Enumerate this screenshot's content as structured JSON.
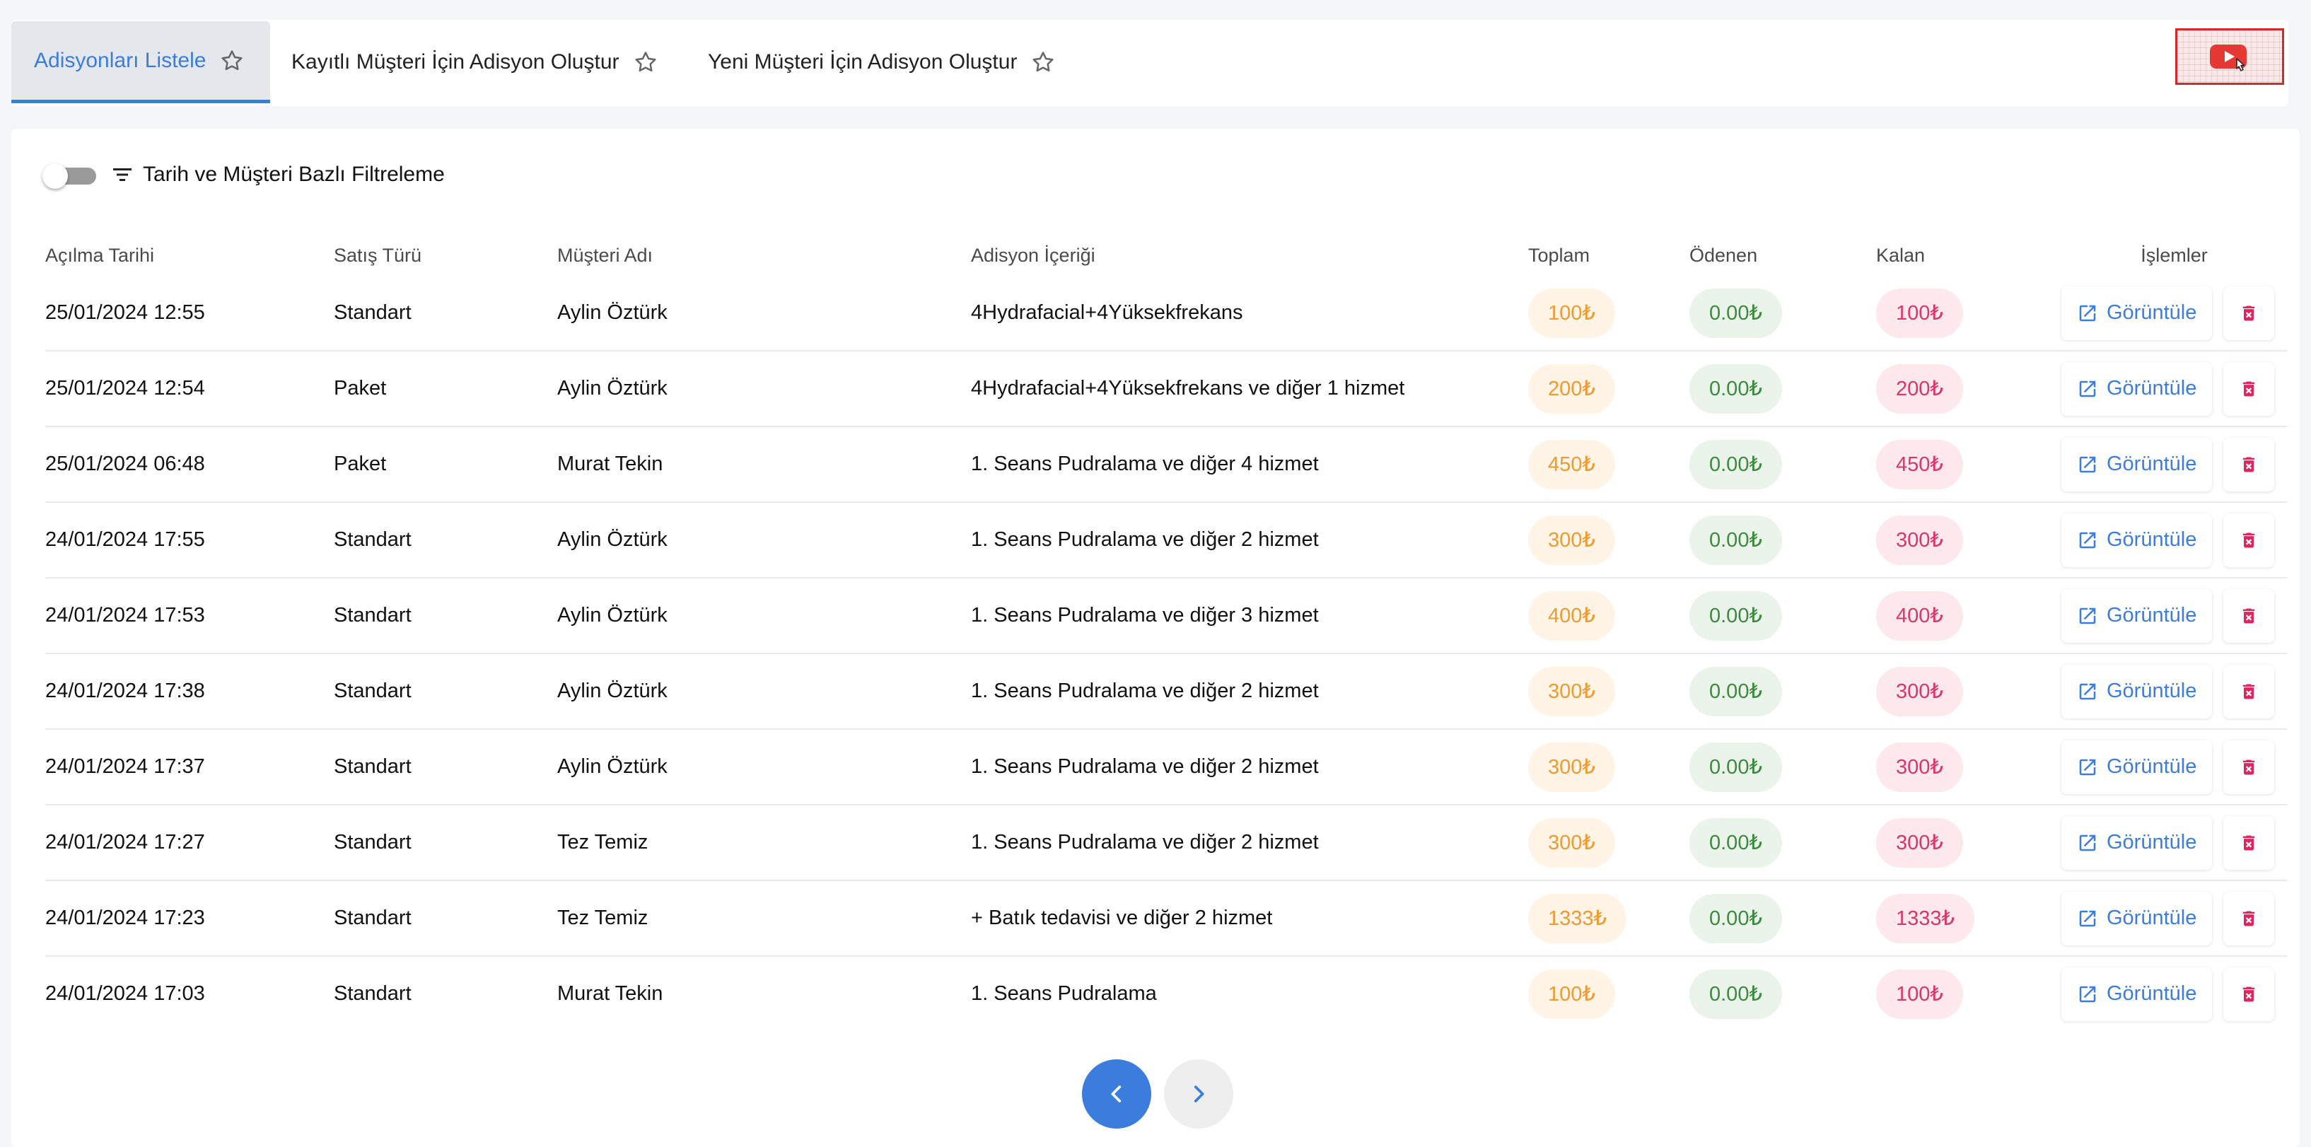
{
  "tabs": [
    {
      "label": "Adisyonları Listele",
      "active": true
    },
    {
      "label": "Kayıtlı Müşteri İçin Adisyon Oluştur",
      "active": false
    },
    {
      "label": "Yeni Müşteri İçin Adisyon Oluştur",
      "active": false
    }
  ],
  "video_button": {
    "icon": "youtube-play-icon",
    "color": "#e53935"
  },
  "filter": {
    "label": "Tarih ve Müşteri Bazlı Filtreleme",
    "enabled": false
  },
  "table": {
    "headers": [
      "Açılma Tarihi",
      "Satış Türü",
      "Müşteri Adı",
      "Adisyon İçeriği",
      "Toplam",
      "Ödenen",
      "Kalan",
      "İşlemler"
    ],
    "view_label": "Görüntüle",
    "rows": [
      {
        "date": "25/01/2024 12:55",
        "type": "Standart",
        "customer": "Aylin Öztürk",
        "content": "4Hydrafacial+4Yüksekfrekans",
        "total": "100₺",
        "paid": "0.00₺",
        "remaining": "100₺"
      },
      {
        "date": "25/01/2024 12:54",
        "type": "Paket",
        "customer": "Aylin Öztürk",
        "content": "4Hydrafacial+4Yüksekfrekans ve diğer 1 hizmet",
        "total": "200₺",
        "paid": "0.00₺",
        "remaining": "200₺"
      },
      {
        "date": "25/01/2024 06:48",
        "type": "Paket",
        "customer": "Murat Tekin",
        "content": "1. Seans Pudralama ve diğer 4 hizmet",
        "total": "450₺",
        "paid": "0.00₺",
        "remaining": "450₺"
      },
      {
        "date": "24/01/2024 17:55",
        "type": "Standart",
        "customer": "Aylin Öztürk",
        "content": "1. Seans Pudralama ve diğer 2 hizmet",
        "total": "300₺",
        "paid": "0.00₺",
        "remaining": "300₺"
      },
      {
        "date": "24/01/2024 17:53",
        "type": "Standart",
        "customer": "Aylin Öztürk",
        "content": "1. Seans Pudralama ve diğer 3 hizmet",
        "total": "400₺",
        "paid": "0.00₺",
        "remaining": "400₺"
      },
      {
        "date": "24/01/2024 17:38",
        "type": "Standart",
        "customer": "Aylin Öztürk",
        "content": "1. Seans Pudralama ve diğer 2 hizmet",
        "total": "300₺",
        "paid": "0.00₺",
        "remaining": "300₺"
      },
      {
        "date": "24/01/2024 17:37",
        "type": "Standart",
        "customer": "Aylin Öztürk",
        "content": "1. Seans Pudralama ve diğer 2 hizmet",
        "total": "300₺",
        "paid": "0.00₺",
        "remaining": "300₺"
      },
      {
        "date": "24/01/2024 17:27",
        "type": "Standart",
        "customer": "Tez Temiz",
        "content": "1. Seans Pudralama ve diğer 2 hizmet",
        "total": "300₺",
        "paid": "0.00₺",
        "remaining": "300₺"
      },
      {
        "date": "24/01/2024 17:23",
        "type": "Standart",
        "customer": "Tez Temiz",
        "content": "+ Batık tedavisi ve diğer 2 hizmet",
        "total": "1333₺",
        "paid": "0.00₺",
        "remaining": "1333₺"
      },
      {
        "date": "24/01/2024 17:03",
        "type": "Standart",
        "customer": "Murat Tekin",
        "content": "1. Seans Pudralama",
        "total": "100₺",
        "paid": "0.00₺",
        "remaining": "100₺"
      }
    ]
  },
  "colors": {
    "accent": "#3b7ddd",
    "total": "#ef9a2f",
    "paid": "#3d8a3f",
    "remaining": "#d9366a",
    "delete": "#e0245e"
  }
}
